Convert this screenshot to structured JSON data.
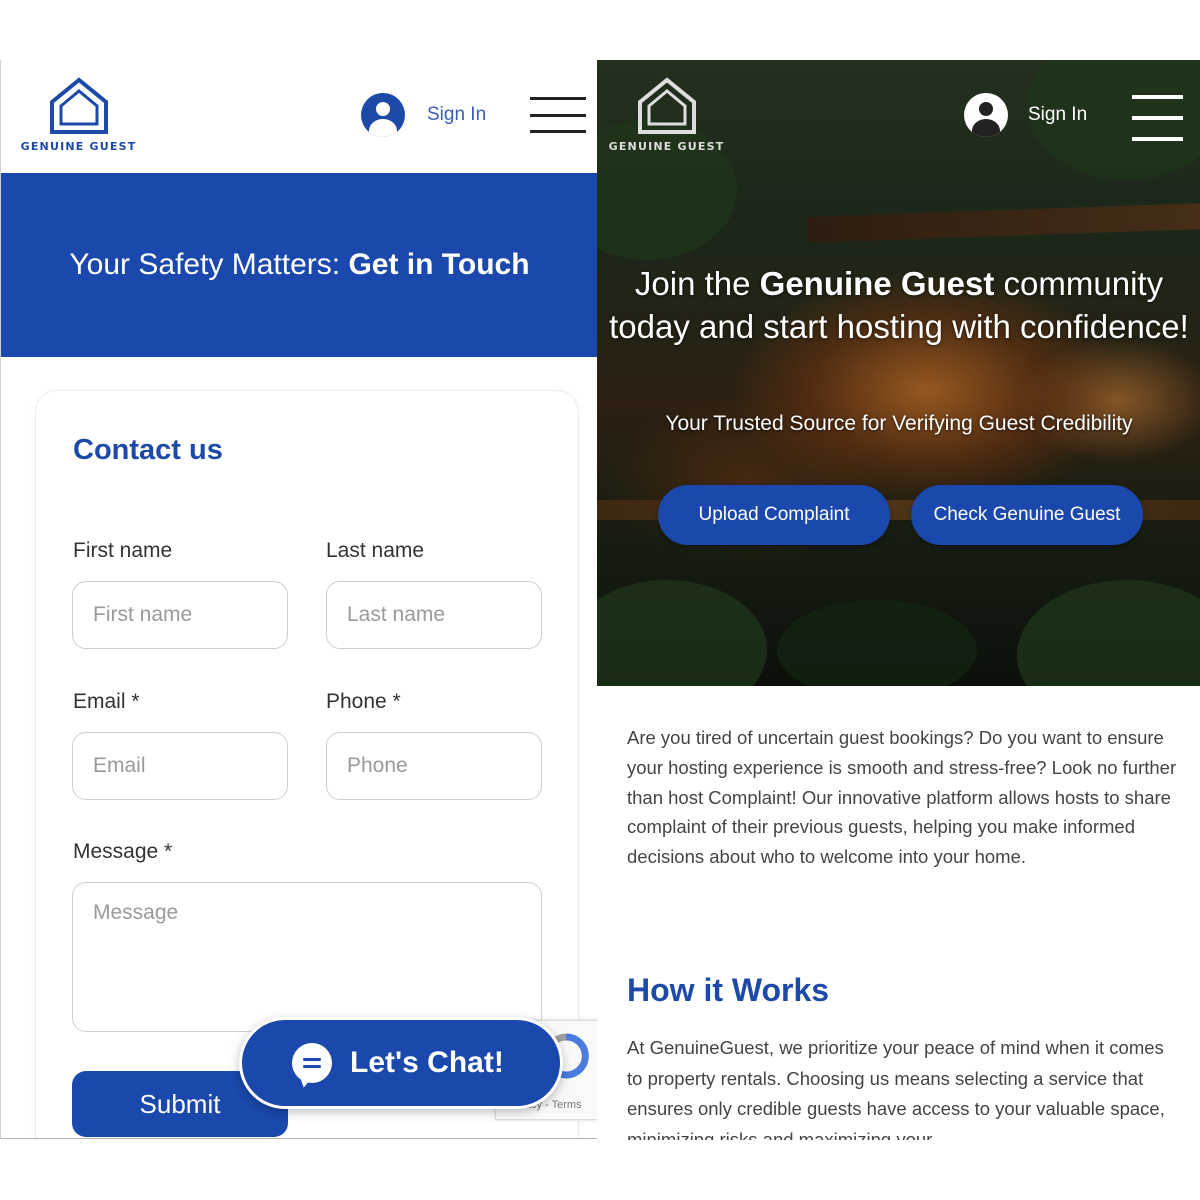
{
  "brand": {
    "logo_text": "GENUINE GUEST"
  },
  "header": {
    "signin_label": "Sign In"
  },
  "contact_page": {
    "banner": {
      "title_prefix": "Your Safety Matters: ",
      "title_bold": "Get in Touch"
    },
    "form": {
      "title": "Contact us",
      "first_name": {
        "label": "First name",
        "placeholder": "First name",
        "value": ""
      },
      "last_name": {
        "label": "Last name",
        "placeholder": "Last name",
        "value": ""
      },
      "email": {
        "label": "Email *",
        "placeholder": "Email",
        "value": ""
      },
      "phone": {
        "label": "Phone *",
        "placeholder": "Phone",
        "value": ""
      },
      "message": {
        "label": "Message *",
        "placeholder": "Message",
        "value": ""
      },
      "submit_label": "Submit"
    },
    "chat_button_label": "Let's Chat!",
    "recaptcha_text": "Privacy - Terms"
  },
  "home_page": {
    "hero": {
      "headline_part1": "Join the ",
      "headline_bold": "Genuine Guest",
      "headline_part2": " community today and start hosting with confidence!",
      "subtitle": "Your Trusted Source for Verifying Guest Credibility",
      "upload_button": "Upload Complaint",
      "check_button": "Check Genuine Guest"
    },
    "intro": "Are you tired of uncertain guest bookings? Do you want to ensure your hosting experience is smooth and stress-free? Look no further than host Complaint! Our innovative platform allows hosts to share complaint of their previous guests, helping you make informed decisions about who to welcome into your home.",
    "how_it_works": {
      "title": "How it Works",
      "text": "At GenuineGuest, we prioritize your peace of mind when it comes to property rentals. Choosing us means selecting a service that ensures only credible guests have access to your valuable space, minimizing risks and maximizing your"
    }
  },
  "colors": {
    "brand_blue": "#1a48ac",
    "heading_blue": "#1d4aa8",
    "text_gray": "#444444"
  },
  "icons": [
    "house-logo-icon",
    "user-avatar-icon",
    "hamburger-menu-icon",
    "chat-bubble-icon",
    "recaptcha-icon"
  ]
}
